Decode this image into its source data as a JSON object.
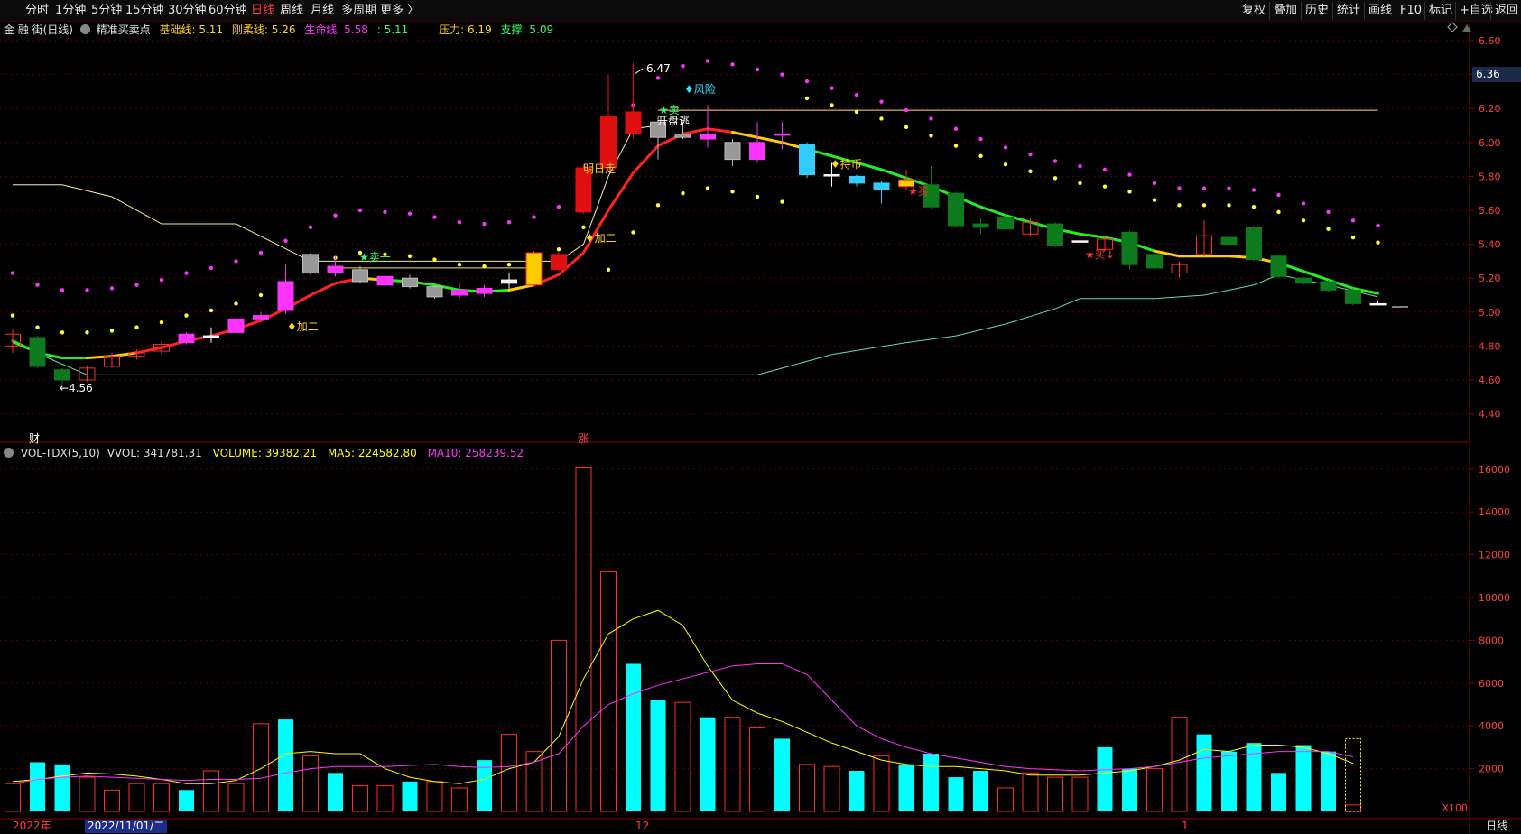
{
  "periods": [
    "分时",
    "1分钟",
    "5分钟",
    "15分钟",
    "30分钟",
    "60分钟",
    "日线",
    "周线",
    "月线",
    "多周期",
    "更多 〉"
  ],
  "active_period": "日线",
  "toolbar": [
    "复权",
    "叠加",
    "历史",
    "统计",
    "画线",
    "F10",
    "标记",
    "+自选",
    "返回"
  ],
  "stock_title": "金 融 街(日线)",
  "indicator": {
    "name": "精准买卖点",
    "items": [
      {
        "label": "基础线: 5.11",
        "color": "#ffd21f"
      },
      {
        "label": "刚柔线: 5.26",
        "color": "#ffd21f"
      },
      {
        "label": "生命线: 5.58",
        "color": "#ff33ff"
      },
      {
        "label": ": 5.11",
        "color": "#33ff66"
      },
      {
        "label": "压力: 6.19",
        "color": "#ffd21f"
      },
      {
        "label": "支撑: 5.09",
        "color": "#33ff66"
      }
    ]
  },
  "vol_legend": {
    "name": "VOL-TDX(5,10)",
    "vvol": "VVOL: 341781.31",
    "volume": "VOLUME: 39382.21",
    "ma5": "MA5: 224582.80",
    "ma10": "MA10: 258239.52"
  },
  "current_price": "6.36",
  "price_axis": [
    "6.60",
    "6.40",
    "6.20",
    "6.00",
    "5.80",
    "5.60",
    "5.40",
    "5.20",
    "5.00",
    "4.80",
    "4.60",
    "4.40"
  ],
  "volume_axis": [
    "16000",
    "14000",
    "12000",
    "10000",
    "8000",
    "6000",
    "4000",
    "2000"
  ],
  "volume_unit": "X100",
  "bottom_dates": {
    "year": "2022年",
    "date": "2022/11/01/二",
    "month": "12",
    "next": "1",
    "period": "日线"
  },
  "annotations": {
    "high": "6.47",
    "low": "←4.56",
    "risk": "♦风险",
    "sell1": "★卖一",
    "sell_top": "★卖",
    "open_escape": "开盘逃",
    "tomorrow": "明日走",
    "add2a": "♦加二",
    "add2b": "♦加二",
    "hold": "♦持币",
    "buy": "★买",
    "buy_low": "★买↓",
    "cai": "财",
    "zhang": "涨"
  },
  "colors": {
    "up": "#ff2a2a",
    "down": "#0e7a1e",
    "volume_down": "#00ffff",
    "ma5": "#ffff00",
    "ma10": "#ff33ff"
  },
  "chart_data": {
    "type": "candlestick",
    "candles": [
      {
        "o": 4.8,
        "c": 4.87,
        "h": 4.9,
        "l": 4.76,
        "col": "up"
      },
      {
        "o": 4.85,
        "c": 4.68,
        "h": 4.86,
        "l": 4.67,
        "col": "down"
      },
      {
        "o": 4.66,
        "c": 4.6,
        "h": 4.67,
        "l": 4.56,
        "col": "down"
      },
      {
        "o": 4.6,
        "c": 4.67,
        "h": 4.68,
        "l": 4.59,
        "col": "up"
      },
      {
        "o": 4.68,
        "c": 4.74,
        "h": 4.76,
        "l": 4.67,
        "col": "up"
      },
      {
        "o": 4.74,
        "c": 4.76,
        "h": 4.78,
        "l": 4.72,
        "col": "up"
      },
      {
        "o": 4.77,
        "c": 4.81,
        "h": 4.83,
        "l": 4.75,
        "col": "up"
      },
      {
        "o": 4.82,
        "c": 4.87,
        "h": 4.88,
        "l": 4.81,
        "col": "magenta"
      },
      {
        "o": 4.86,
        "c": 4.86,
        "h": 4.91,
        "l": 4.82,
        "col": "white"
      },
      {
        "o": 4.88,
        "c": 4.96,
        "h": 5.0,
        "l": 4.87,
        "col": "magenta"
      },
      {
        "o": 4.96,
        "c": 4.98,
        "h": 5.0,
        "l": 4.95,
        "col": "magenta"
      },
      {
        "o": 5.01,
        "c": 5.18,
        "h": 5.28,
        "l": 4.99,
        "col": "magenta"
      },
      {
        "o": 5.23,
        "c": 5.34,
        "h": 5.35,
        "l": 5.22,
        "col": "gray"
      },
      {
        "o": 5.27,
        "c": 5.23,
        "h": 5.33,
        "l": 5.21,
        "col": "magenta"
      },
      {
        "o": 5.25,
        "c": 5.18,
        "h": 5.27,
        "l": 5.17,
        "col": "gray"
      },
      {
        "o": 5.16,
        "c": 5.21,
        "h": 5.22,
        "l": 5.15,
        "col": "magenta"
      },
      {
        "o": 5.2,
        "c": 5.15,
        "h": 5.22,
        "l": 5.14,
        "col": "gray"
      },
      {
        "o": 5.15,
        "c": 5.09,
        "h": 5.16,
        "l": 5.08,
        "col": "gray"
      },
      {
        "o": 5.1,
        "c": 5.13,
        "h": 5.17,
        "l": 5.08,
        "col": "magenta"
      },
      {
        "o": 5.11,
        "c": 5.14,
        "h": 5.16,
        "l": 5.09,
        "col": "magenta"
      },
      {
        "o": 5.17,
        "c": 5.19,
        "h": 5.23,
        "l": 5.14,
        "col": "white"
      },
      {
        "o": 5.16,
        "c": 5.35,
        "h": 5.36,
        "l": 5.15,
        "col": "yellowred"
      },
      {
        "o": 5.25,
        "c": 5.34,
        "h": 5.35,
        "l": 5.24,
        "col": "red"
      },
      {
        "o": 5.59,
        "c": 5.85,
        "h": 5.87,
        "l": 5.58,
        "col": "red"
      },
      {
        "o": 5.85,
        "c": 6.15,
        "h": 6.4,
        "l": 5.83,
        "col": "red"
      },
      {
        "o": 6.05,
        "c": 6.18,
        "h": 6.47,
        "l": 6.02,
        "col": "red"
      },
      {
        "o": 6.03,
        "c": 6.12,
        "h": 6.15,
        "l": 5.9,
        "col": "gray"
      },
      {
        "o": 6.05,
        "c": 6.03,
        "h": 6.12,
        "l": 6.02,
        "col": "gray"
      },
      {
        "o": 6.05,
        "c": 6.02,
        "h": 6.22,
        "l": 5.97,
        "col": "magenta"
      },
      {
        "o": 6.0,
        "c": 5.9,
        "h": 6.02,
        "l": 5.86,
        "col": "gray"
      },
      {
        "o": 5.9,
        "c": 6.0,
        "h": 6.12,
        "l": 5.88,
        "col": "magenta"
      },
      {
        "o": 6.05,
        "c": 6.05,
        "h": 6.12,
        "l": 5.96,
        "col": "magenta"
      },
      {
        "o": 5.99,
        "c": 5.81,
        "h": 6.0,
        "l": 5.79,
        "col": "cyan"
      },
      {
        "o": 5.81,
        "c": 5.81,
        "h": 5.88,
        "l": 5.74,
        "col": "white"
      },
      {
        "o": 5.8,
        "c": 5.76,
        "h": 5.81,
        "l": 5.74,
        "col": "cyan"
      },
      {
        "o": 5.76,
        "c": 5.72,
        "h": 5.77,
        "l": 5.64,
        "col": "cyan"
      },
      {
        "o": 5.74,
        "c": 5.78,
        "h": 5.84,
        "l": 5.72,
        "col": "yellowred"
      },
      {
        "o": 5.75,
        "c": 5.62,
        "h": 5.86,
        "l": 5.61,
        "col": "down"
      },
      {
        "o": 5.7,
        "c": 5.51,
        "h": 5.71,
        "l": 5.5,
        "col": "down"
      },
      {
        "o": 5.52,
        "c": 5.5,
        "h": 5.55,
        "l": 5.46,
        "col": "down"
      },
      {
        "o": 5.56,
        "c": 5.49,
        "h": 5.58,
        "l": 5.48,
        "col": "down"
      },
      {
        "o": 5.46,
        "c": 5.53,
        "h": 5.55,
        "l": 5.45,
        "col": "up"
      },
      {
        "o": 5.52,
        "c": 5.39,
        "h": 5.53,
        "l": 5.38,
        "col": "down"
      },
      {
        "o": 5.42,
        "c": 5.42,
        "h": 5.45,
        "l": 5.37,
        "col": "white"
      },
      {
        "o": 5.37,
        "c": 5.43,
        "h": 5.45,
        "l": 5.36,
        "col": "up"
      },
      {
        "o": 5.47,
        "c": 5.28,
        "h": 5.48,
        "l": 5.25,
        "col": "down"
      },
      {
        "o": 5.34,
        "c": 5.26,
        "h": 5.35,
        "l": 5.25,
        "col": "down"
      },
      {
        "o": 5.23,
        "c": 5.28,
        "h": 5.3,
        "l": 5.2,
        "col": "up"
      },
      {
        "o": 5.34,
        "c": 5.45,
        "h": 5.54,
        "l": 5.33,
        "col": "up"
      },
      {
        "o": 5.44,
        "c": 5.4,
        "h": 5.45,
        "l": 5.39,
        "col": "down"
      },
      {
        "o": 5.5,
        "c": 5.31,
        "h": 5.51,
        "l": 5.3,
        "col": "down"
      },
      {
        "o": 5.33,
        "c": 5.21,
        "h": 5.34,
        "l": 5.2,
        "col": "down"
      },
      {
        "o": 5.2,
        "c": 5.17,
        "h": 5.21,
        "l": 5.16,
        "col": "down"
      },
      {
        "o": 5.18,
        "c": 5.13,
        "h": 5.19,
        "l": 5.12,
        "col": "down"
      },
      {
        "o": 5.13,
        "c": 5.05,
        "h": 5.14,
        "l": 5.04,
        "col": "down"
      },
      {
        "o": 5.05,
        "c": 5.05,
        "h": 5.07,
        "l": 5.04,
        "col": "white"
      }
    ],
    "volumes": [
      1300,
      2300,
      2200,
      1600,
      1000,
      1300,
      1300,
      1000,
      1900,
      1300,
      4100,
      4300,
      2600,
      1800,
      1200,
      1200,
      1400,
      1400,
      1100,
      2400,
      3600,
      2800,
      8000,
      16100,
      11200,
      6900,
      5200,
      5100,
      4400,
      4400,
      3900,
      3400,
      2200,
      2100,
      1900,
      2600,
      2200,
      2700,
      1600,
      1900,
      1100,
      1800,
      1600,
      1600,
      3000,
      2000,
      2000,
      4400,
      3600,
      2800,
      3200,
      1800,
      3100,
      2800,
      300
    ],
    "volume_colors": [
      "up",
      "down",
      "down",
      "up",
      "up",
      "up",
      "up",
      "down",
      "up",
      "up",
      "up",
      "down",
      "up",
      "down",
      "up",
      "up",
      "down",
      "up",
      "up",
      "down",
      "up",
      "up",
      "up",
      "up",
      "up",
      "down",
      "down",
      "up",
      "down",
      "up",
      "up",
      "down",
      "up",
      "up",
      "down",
      "up",
      "down",
      "down",
      "down",
      "down",
      "up",
      "up",
      "up",
      "up",
      "down",
      "down",
      "up",
      "up",
      "down",
      "down",
      "down",
      "down",
      "down",
      "down",
      "up"
    ],
    "life_line": [
      4.83,
      4.76,
      4.73,
      4.73,
      4.74,
      4.76,
      4.79,
      4.83,
      4.86,
      4.9,
      4.95,
      5.02,
      5.1,
      5.17,
      5.2,
      5.19,
      5.18,
      5.16,
      5.13,
      5.12,
      5.13,
      5.16,
      5.22,
      5.35,
      5.6,
      5.82,
      5.98,
      6.05,
      6.08,
      6.06,
      6.03,
      6.0,
      5.96,
      5.92,
      5.88,
      5.84,
      5.79,
      5.74,
      5.68,
      5.62,
      5.57,
      5.53,
      5.49,
      5.46,
      5.44,
      5.41,
      5.36,
      5.33,
      5.33,
      5.33,
      5.32,
      5.29,
      5.24,
      5.19,
      5.14,
      5.11
    ],
    "life_line_colors": [
      "down",
      "down",
      "down",
      "yellow",
      "yellow",
      "up",
      "up",
      "up",
      "up",
      "up",
      "up",
      "up",
      "up",
      "up",
      "yellow",
      "down",
      "down",
      "down",
      "down",
      "down",
      "yellow",
      "up",
      "up",
      "up",
      "up",
      "up",
      "up",
      "up",
      "up",
      "yellow",
      "yellow",
      "yellow",
      "down",
      "down",
      "down",
      "down",
      "down",
      "down",
      "down",
      "down",
      "down",
      "down",
      "down",
      "down",
      "down",
      "down",
      "yellow",
      "yellow",
      "yellow",
      "yellow",
      "yellow",
      "down",
      "down",
      "down",
      "down",
      "down"
    ],
    "ma5": [
      1400,
      1500,
      1650,
      1800,
      1750,
      1650,
      1500,
      1300,
      1300,
      1450,
      2000,
      2700,
      2800,
      2700,
      2700,
      2000,
      1600,
      1400,
      1300,
      1500,
      2000,
      2300,
      3500,
      6200,
      8300,
      9000,
      9400,
      8700,
      6800,
      5200,
      4600,
      4200,
      3700,
      3200,
      2800,
      2400,
      2200,
      2100,
      2100,
      2000,
      1900,
      1700,
      1700,
      1700,
      1800,
      1900,
      2100,
      2400,
      2900,
      2800,
      3100,
      3100,
      3000,
      2700,
      2250
    ],
    "ma10": [
      1300,
      1500,
      1600,
      1650,
      1600,
      1550,
      1500,
      1450,
      1500,
      1500,
      1550,
      1800,
      2000,
      2100,
      2100,
      2100,
      2150,
      2200,
      2100,
      2050,
      2100,
      2300,
      2700,
      4000,
      5000,
      5500,
      5900,
      6200,
      6500,
      6800,
      6900,
      6900,
      6400,
      5200,
      4000,
      3400,
      3000,
      2700,
      2500,
      2300,
      2100,
      2000,
      1950,
      1900,
      1950,
      2000,
      2100,
      2300,
      2500,
      2600,
      2700,
      2800,
      2800,
      2800,
      2550
    ]
  }
}
